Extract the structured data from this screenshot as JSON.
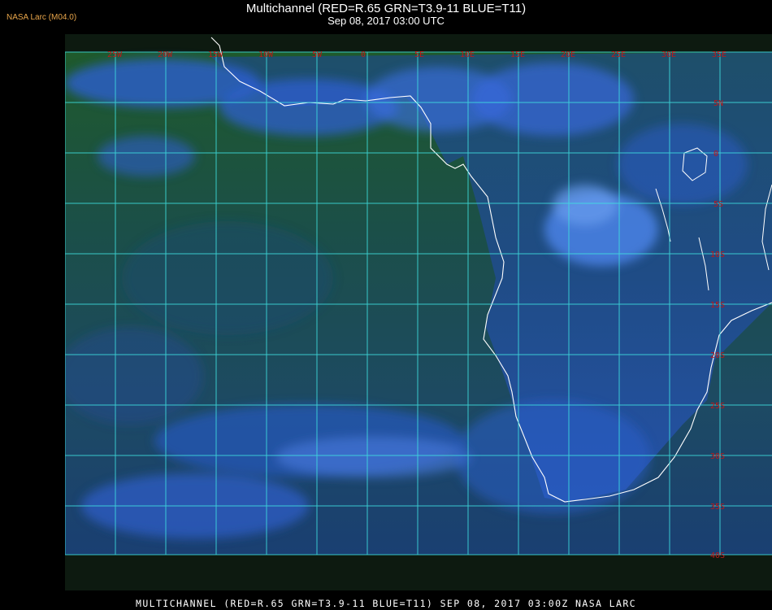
{
  "header": {
    "credit": "NASA Larc (M04.0)",
    "title": "Multichannel (RED=R.65 GRN=T3.9-11 BLUE=T11)",
    "datetime": "Sep 08, 2017 03:00 UTC"
  },
  "footer": {
    "caption": "MULTICHANNEL (RED=R.65 GRN=T3.9-11 BLUE=T11) SEP 08, 2017 03:00Z  NASA LARC"
  },
  "map": {
    "longitude_labels": [
      "25W",
      "20W",
      "15W",
      "10W",
      "5W",
      "0",
      "5E",
      "10E",
      "15E",
      "20E",
      "25E",
      "30E",
      "35E"
    ],
    "latitude_labels": [
      "5N",
      "0",
      "5S",
      "10S",
      "15S",
      "20S",
      "25S",
      "30S",
      "35S",
      "40S"
    ],
    "grid_color": "#3fe0e0",
    "label_color": "#c21818",
    "coast_color": "#ffffff",
    "ocean_color": "#1a4a2a",
    "cloud_color": "#2f62d8"
  }
}
